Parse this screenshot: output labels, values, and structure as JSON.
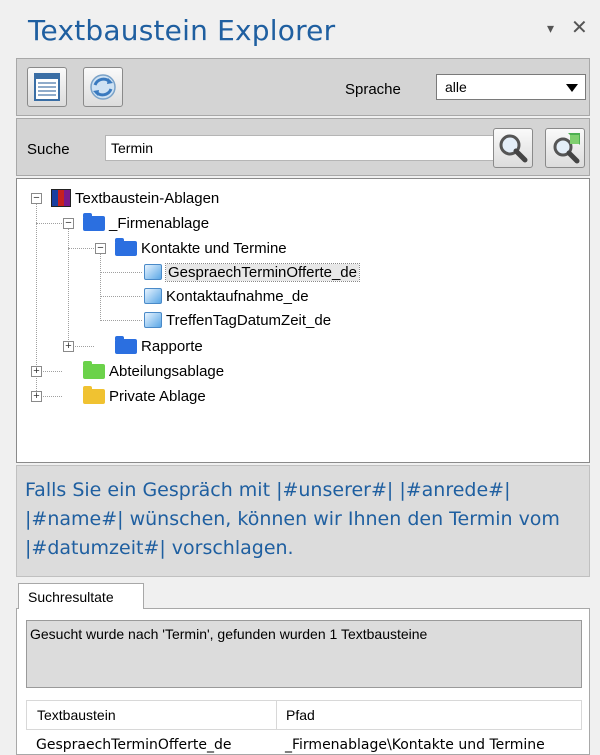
{
  "window": {
    "title": "Textbaustein Explorer",
    "pin_glyph": "▾",
    "close_glyph": "✕"
  },
  "toolbar": {
    "language_label": "Sprache",
    "language_value": "alle"
  },
  "search": {
    "label": "Suche",
    "value": "Termin"
  },
  "tree": {
    "root": "Textbaustein-Ablagen",
    "firmenablage": "_Firmenablage",
    "kontakte": "Kontakte und Termine",
    "item1": "GespraechTerminOfferte_de",
    "item2": "Kontaktaufnahme_de",
    "item3": "TreffenTagDatumZeit_de",
    "rapporte": "Rapporte",
    "abteilung": "Abteilungsablage",
    "privat": "Private Ablage",
    "collapse_glyph": "−",
    "expand_glyph": "+"
  },
  "preview": {
    "text": "Falls Sie ein Gespräch mit |#unserer#| |#anrede#| |#name#| wünschen, können wir Ihnen den Termin vom |#datumzeit#| vorschlagen."
  },
  "results": {
    "tab_label": "Suchresultate",
    "status": "Gesucht wurde nach 'Termin', gefunden wurden 1 Textbausteine",
    "columns": [
      "Textbaustein",
      "Pfad"
    ],
    "rows": [
      [
        "GespraechTerminOfferte_de",
        "_Firmenablage\\Kontakte und Termine"
      ]
    ]
  },
  "colors": {
    "accent": "#1f5fa0",
    "panel": "#d4d4d4"
  },
  "icons": [
    "list-view-icon",
    "refresh-icon",
    "search-icon",
    "clear-search-icon",
    "books-icon",
    "folder-icon",
    "document-icon"
  ]
}
